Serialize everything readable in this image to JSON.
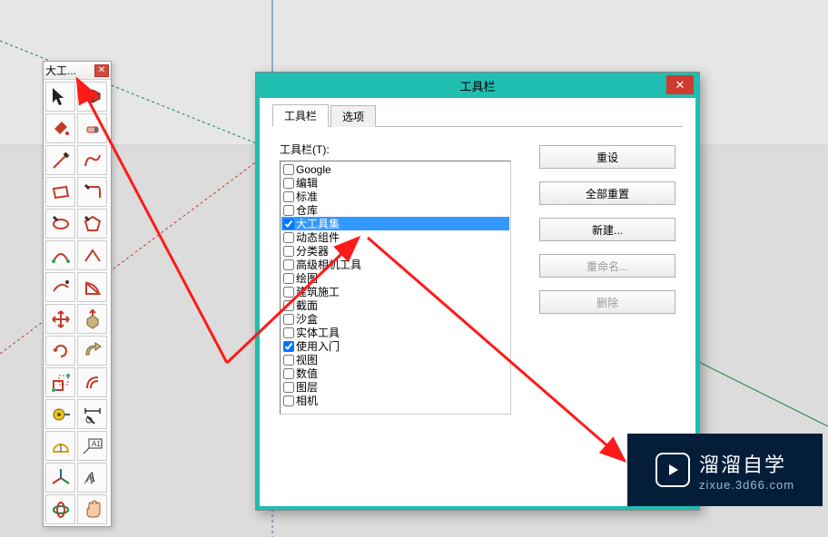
{
  "toolbar": {
    "title": "大工...",
    "close_tooltip": "x"
  },
  "dialog": {
    "title": "工具栏",
    "tabs": [
      {
        "label": "工具栏",
        "active": true
      },
      {
        "label": "选项",
        "active": false
      }
    ],
    "list_label": "工具栏(T):",
    "items": [
      {
        "label": "Google",
        "checked": false
      },
      {
        "label": "编辑",
        "checked": false
      },
      {
        "label": "标准",
        "checked": false
      },
      {
        "label": "仓库",
        "checked": false
      },
      {
        "label": "大工具集",
        "checked": true,
        "selected": true
      },
      {
        "label": "动态组件",
        "checked": false
      },
      {
        "label": "分类器",
        "checked": false
      },
      {
        "label": "高级相机工具",
        "checked": false
      },
      {
        "label": "绘图",
        "checked": false
      },
      {
        "label": "建筑施工",
        "checked": false
      },
      {
        "label": "截面",
        "checked": false
      },
      {
        "label": "沙盒",
        "checked": false
      },
      {
        "label": "实体工具",
        "checked": false
      },
      {
        "label": "使用入门",
        "checked": true
      },
      {
        "label": "视图",
        "checked": false
      },
      {
        "label": "数值",
        "checked": false
      },
      {
        "label": "图层",
        "checked": false
      },
      {
        "label": "相机",
        "checked": false
      }
    ],
    "buttons": {
      "reset": "重设",
      "reset_all": "全部重置",
      "new": "新建...",
      "rename": "重命名...",
      "delete": "删除"
    }
  },
  "watermark": {
    "main": "溜溜自学",
    "sub": "zixue.3d66.com"
  }
}
